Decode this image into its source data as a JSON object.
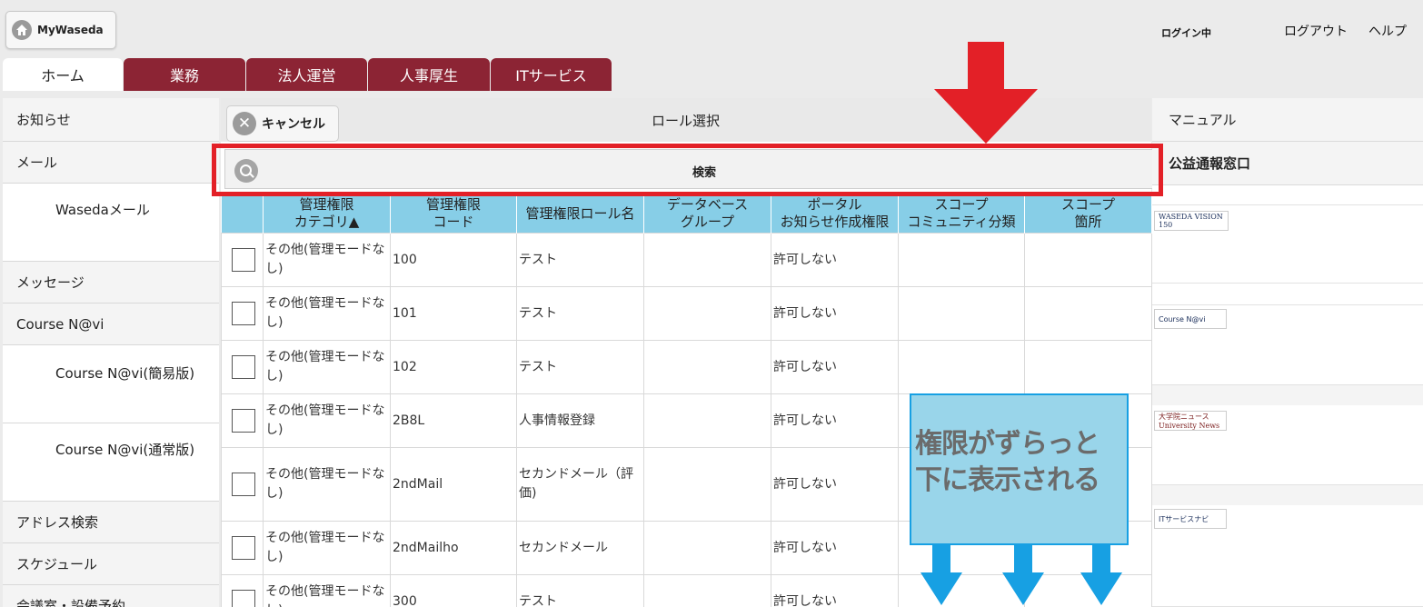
{
  "header": {
    "logo_label": "MyWaseda",
    "login_status": "ログイン中",
    "logout_label": "ログアウト",
    "help_label": "ヘルプ"
  },
  "tabs": [
    {
      "label": "ホーム",
      "active": true
    },
    {
      "label": "業務",
      "active": false
    },
    {
      "label": "法人運営",
      "active": false
    },
    {
      "label": "人事厚生",
      "active": false
    },
    {
      "label": "ITサービス",
      "active": false
    }
  ],
  "left_menu": [
    "お知らせ",
    "メール",
    "Wasedaメール",
    "メッセージ",
    "Course N@vi",
    "Course N@vi(簡易版)",
    "Course N@vi(通常版)",
    "アドレス検索",
    "スケジュール",
    "会議室・設備予約"
  ],
  "role_panel": {
    "cancel_label": "キャンセル",
    "title": "ロール選択",
    "search_label": "検索"
  },
  "table": {
    "headers": [
      "",
      "管理権限\nカテゴリ▲",
      "管理権限\nコード",
      "管理権限ロール名",
      "データベース\nグループ",
      "ポータル\nお知らせ作成権限",
      "スコープ\nコミュニティ分類",
      "スコープ\n箇所"
    ],
    "rows": [
      {
        "category": "その他(管理モードなし)",
        "code": "100",
        "name": "テスト",
        "db": "",
        "portal": "許可しない",
        "scope_comm": "",
        "scope_loc": ""
      },
      {
        "category": "その他(管理モードなし)",
        "code": "101",
        "name": "テスト",
        "db": "",
        "portal": "許可しない",
        "scope_comm": "",
        "scope_loc": ""
      },
      {
        "category": "その他(管理モードなし)",
        "code": "102",
        "name": "テスト",
        "db": "",
        "portal": "許可しない",
        "scope_comm": "",
        "scope_loc": ""
      },
      {
        "category": "その他(管理モードなし)",
        "code": "2B8L",
        "name": "人事情報登録",
        "db": "",
        "portal": "許可しない",
        "scope_comm": "",
        "scope_loc": ""
      },
      {
        "category": "その他(管理モードなし)",
        "code": "2ndMail",
        "name": "セカンドメール（評価)",
        "db": "",
        "portal": "許可しない",
        "scope_comm": "",
        "scope_loc": ""
      },
      {
        "category": "その他(管理モードなし)",
        "code": "2ndMailho",
        "name": "セカンドメール",
        "db": "",
        "portal": "許可しない",
        "scope_comm": "",
        "scope_loc": ""
      },
      {
        "category": "その他(管理モードなし)",
        "code": "300",
        "name": "テスト",
        "db": "",
        "portal": "許可しない",
        "scope_comm": "",
        "scope_loc": ""
      }
    ]
  },
  "right_menu": {
    "manual": "マニュアル",
    "whistle": "公益通報窓口",
    "banners": [
      "WASEDA VISION 150",
      "Course N@vi",
      "大学院ニュース University News",
      "ITサービスナビ"
    ]
  },
  "annotation": {
    "note_line1": "権限がずらっと",
    "note_line2": "下に表示される",
    "red_color": "#e32027",
    "blue_color": "#17a0e3"
  }
}
